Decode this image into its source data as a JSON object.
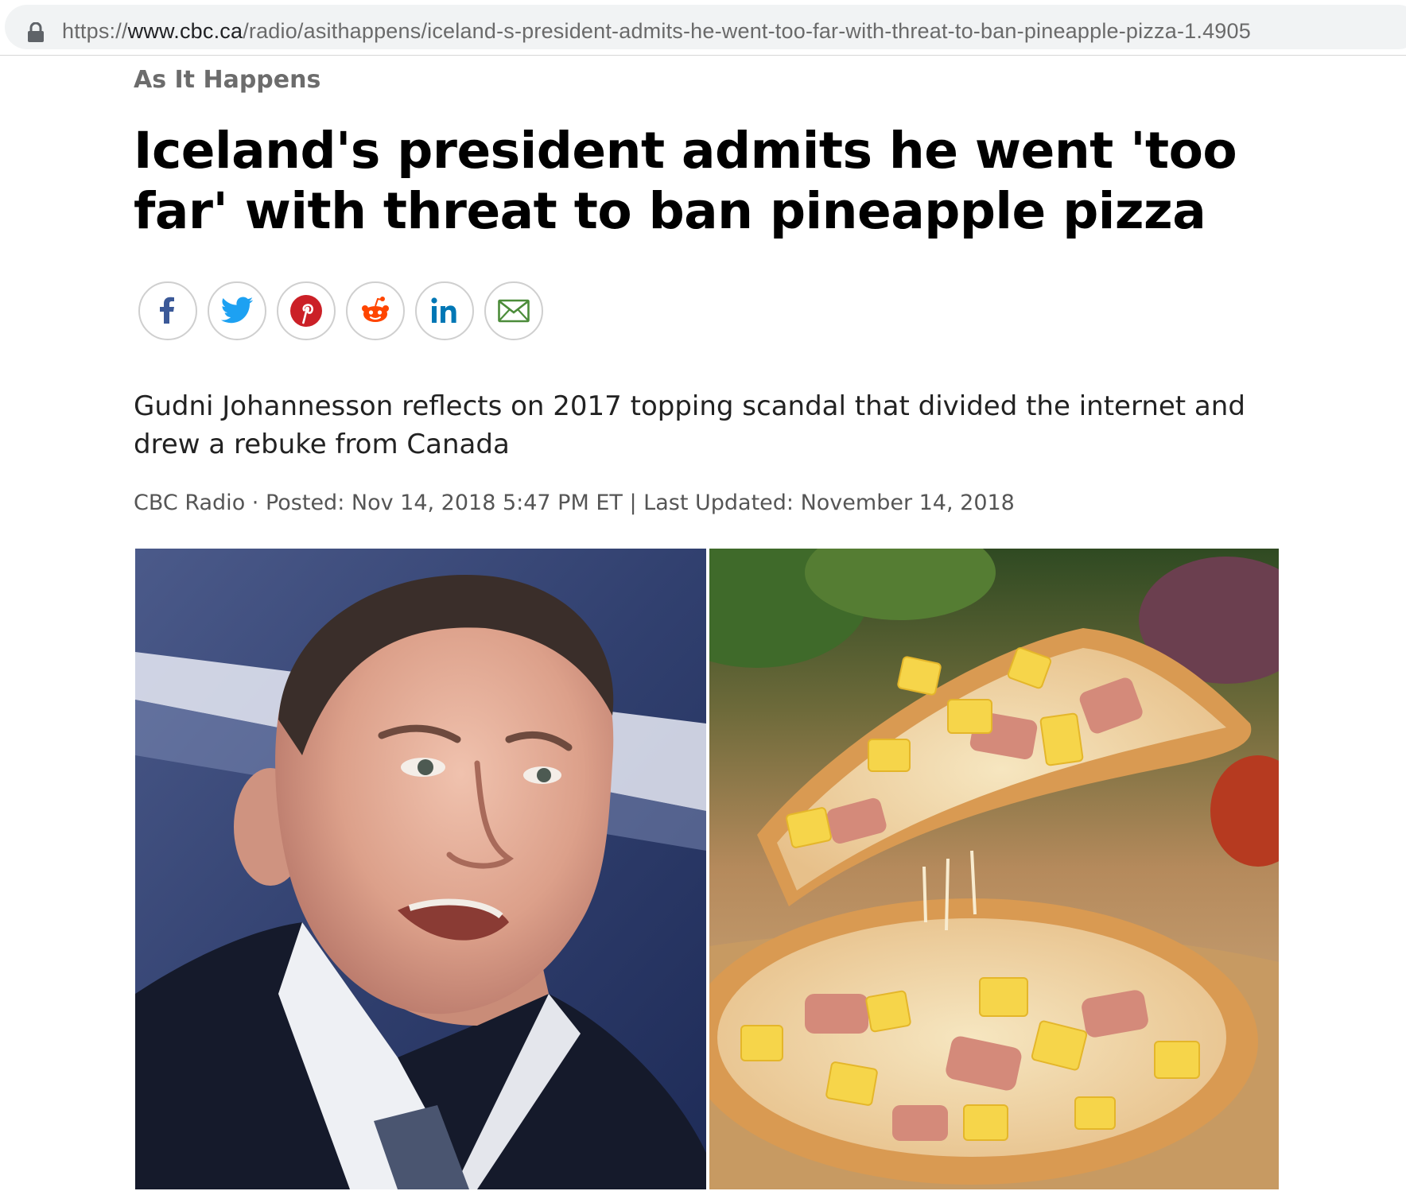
{
  "browser": {
    "url_scheme": "https://",
    "url_host": "www.cbc.ca",
    "url_path": "/radio/asithappens/iceland-s-president-admits-he-went-too-far-with-threat-to-ban-pineapple-pizza-1.4905"
  },
  "article": {
    "section": "As It Happens",
    "headline": "Iceland's president admits he went 'too far' with threat to ban pineapple pizza",
    "deck": "Gudni Johannesson reflects on 2017 topping scandal that divided the internet and drew a rebuke from Canada",
    "byline": "CBC Radio · Posted: Nov 14, 2018 5:47 PM ET | Last Updated: November 14, 2018"
  },
  "share": {
    "buttons": [
      {
        "icon": "facebook-icon",
        "color": "#3b5998"
      },
      {
        "icon": "twitter-icon",
        "color": "#1da1f2"
      },
      {
        "icon": "pinterest-icon",
        "color": "#cb2027"
      },
      {
        "icon": "reddit-icon",
        "color": "#ff4500"
      },
      {
        "icon": "linkedin-icon",
        "color": "#0077b5"
      },
      {
        "icon": "email-icon",
        "color": "#4c8c3a"
      }
    ]
  },
  "colors": {
    "headline": "#000000",
    "kicker": "#6c6c6c",
    "body": "#222222",
    "meta": "#555555"
  }
}
